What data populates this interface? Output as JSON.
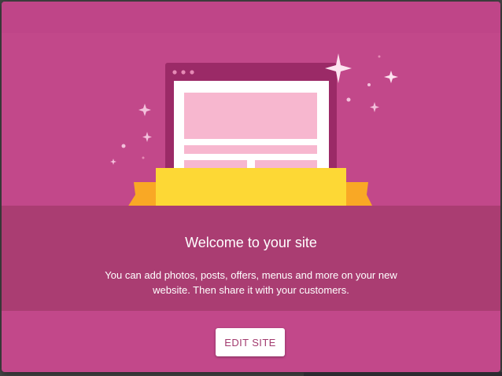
{
  "dialog": {
    "title": "Welcome to your site",
    "description": "You can add photos, posts, offers, menus and more on your new website. Then share it with your customers.",
    "edit_button_label": "EDIT SITE"
  },
  "illustration": {
    "icon": "website-ribbon-illustration",
    "sparkle_icon": "sparkle-icon"
  },
  "colors": {
    "dialog_bg": "#c2488a",
    "text_band_bg": "#aa3d72",
    "browser_frame": "#9b2a67",
    "content_block": "#f7b7cf",
    "ribbon_front": "#fdd835",
    "ribbon_tail": "#f9a825",
    "button_text": "#a23a6e"
  }
}
